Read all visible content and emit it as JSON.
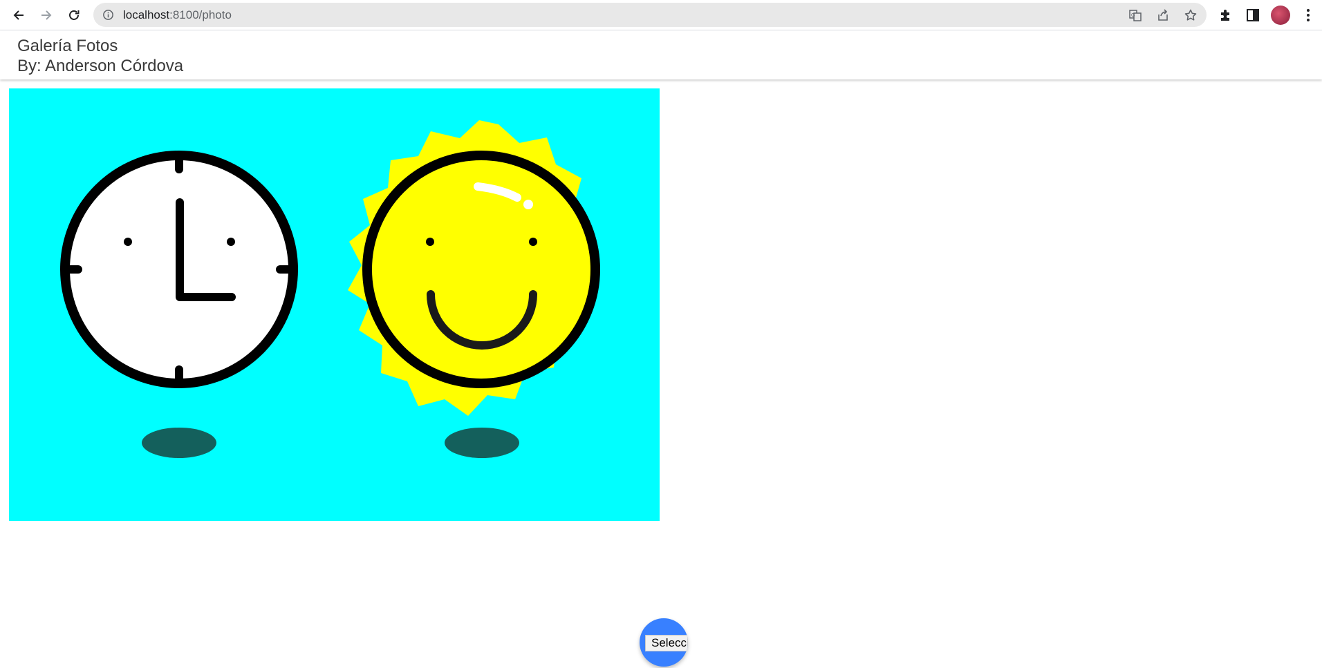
{
  "browser": {
    "url_host": "localhost",
    "url_path": ":8100/photo",
    "icons": [
      "back-arrow-icon",
      "forward-arrow-icon",
      "reload-icon",
      "info-icon",
      "translate-icon",
      "share-icon",
      "bookmark-star-icon",
      "extensions-puzzle-icon",
      "side-panel-icon",
      "profile-avatar",
      "kebab-menu-icon"
    ]
  },
  "header": {
    "title": "Galería Fotos",
    "subtitle": "By: Anderson Córdova"
  },
  "photo": {
    "description_icons": [
      "clock-icon",
      "smiling-sun-icon"
    ],
    "background_color": "#00ffff"
  },
  "fab": {
    "label": "Selecci",
    "color": "#3880ff"
  }
}
